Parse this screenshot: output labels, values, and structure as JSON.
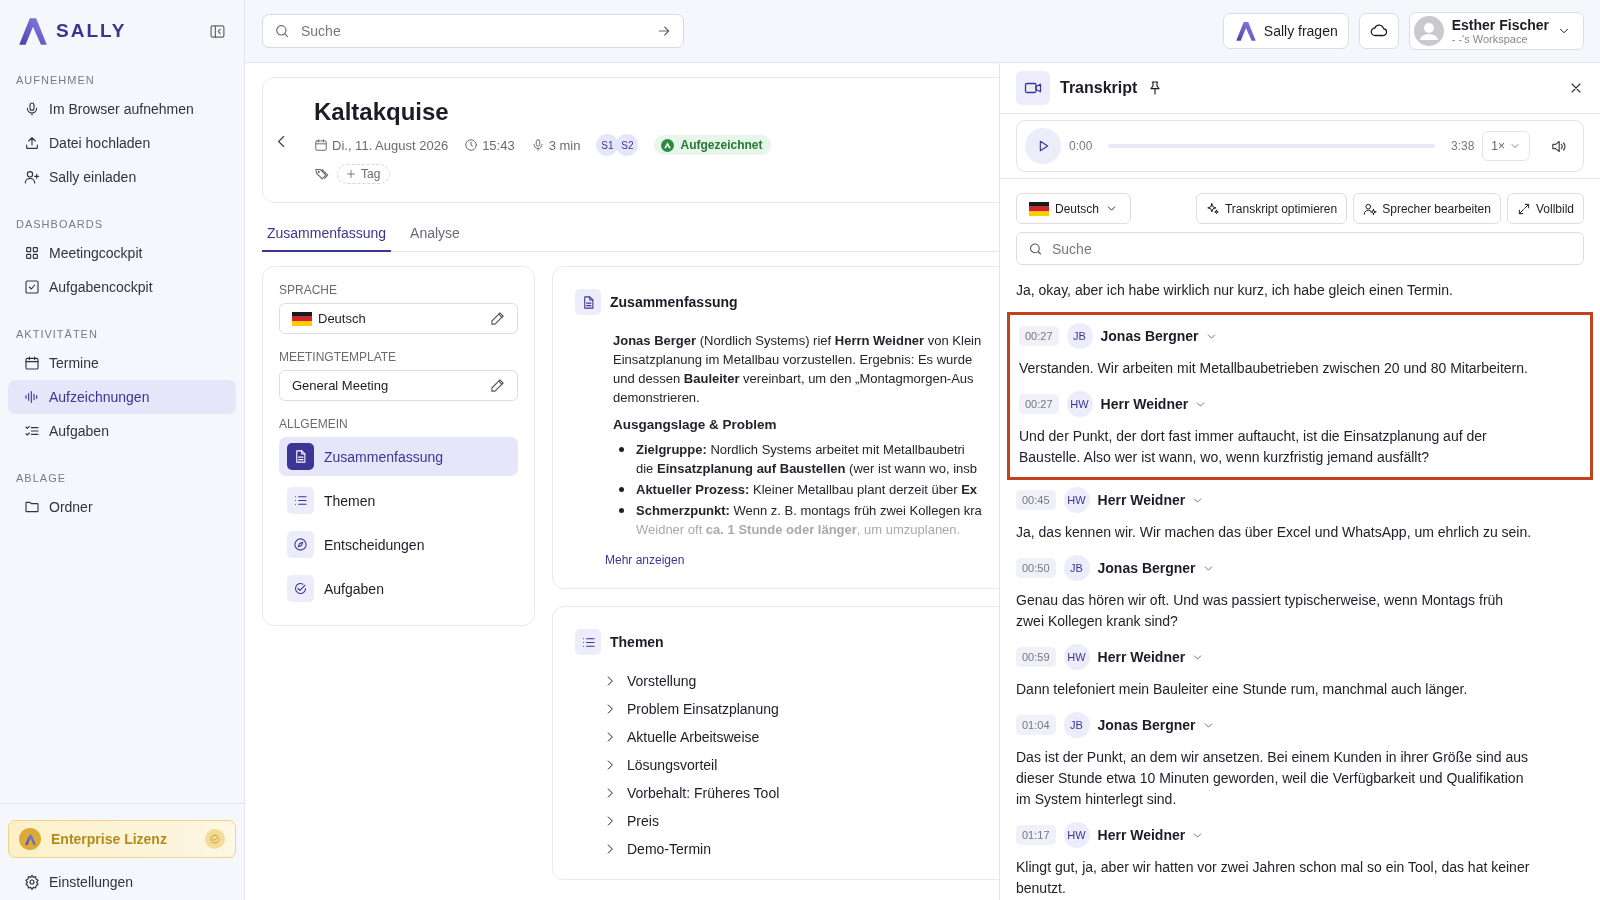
{
  "sidebar": {
    "logo": "SALLY",
    "sections": [
      {
        "title": "AUFNEHMEN",
        "items": [
          {
            "label": "Im Browser aufnehmen",
            "kind": "mic",
            "selected": false
          },
          {
            "label": "Datei hochladen",
            "kind": "upload",
            "selected": false
          },
          {
            "label": "Sally einladen",
            "kind": "invite",
            "selected": false
          }
        ]
      },
      {
        "title": "DASHBOARDS",
        "items": [
          {
            "label": "Meetingcockpit",
            "kind": "grid",
            "selected": false
          },
          {
            "label": "Aufgabencockpit",
            "kind": "checkbox",
            "selected": false
          }
        ]
      },
      {
        "title": "AKTIVITÄTEN",
        "items": [
          {
            "label": "Termine",
            "kind": "calendar",
            "selected": false
          },
          {
            "label": "Aufzeichnungen",
            "kind": "wave",
            "selected": true
          },
          {
            "label": "Aufgaben",
            "kind": "tasks",
            "selected": false
          }
        ]
      },
      {
        "title": "ABLAGE",
        "items": [
          {
            "label": "Ordner",
            "kind": "folder",
            "selected": false
          }
        ]
      }
    ],
    "license": "Enterprise Lizenz",
    "settings": "Einstellungen"
  },
  "topbar": {
    "search_placeholder": "Suche",
    "ask_button": "Sally fragen",
    "user": {
      "name": "Esther Fischer",
      "workspace": "- -'s Workspace"
    }
  },
  "meeting": {
    "title": "Kaltakquise",
    "date": "Di., 11. August 2026",
    "time": "15:43",
    "duration": "3 min",
    "speakers": [
      "S1",
      "S2"
    ],
    "status": "Aufgezeichnet",
    "tag_button": "Tag"
  },
  "tabs": [
    {
      "label": "Zusammenfassung",
      "selected": true
    },
    {
      "label": "Analyse",
      "selected": false
    }
  ],
  "settings_card": {
    "language_label": "SPRACHE",
    "language": "Deutsch",
    "template_label": "MEETINGTEMPLATE",
    "template": "General Meeting",
    "section_label": "ALLGEMEIN",
    "nav": [
      {
        "label": "Zusammenfassung",
        "kind": "document",
        "selected": true
      },
      {
        "label": "Themen",
        "kind": "list",
        "selected": false
      },
      {
        "label": "Entscheidungen",
        "kind": "compass",
        "selected": false
      },
      {
        "label": "Aufgaben",
        "kind": "check",
        "selected": false
      }
    ]
  },
  "summary_card": {
    "title": "Zusammenfassung",
    "intro_lines": [
      "**Jonas Berger** (Nordlich Systems) rief **Herrn Weidner** von Klein",
      "Einsatzplanung im Metallbau vorzustellen. Ergebnis: Es wurde",
      "und dessen **Bauleiter** vereinbart, um den „Montagmorgen-Aus",
      "demonstrieren."
    ],
    "heading": "Ausgangslage & Problem",
    "bullets": [
      {
        "lines": [
          "**Zielgruppe:** Nordlich Systems arbeitet mit Metallbaubetri",
          "die **Einsatzplanung auf Baustellen** (wer ist wann wo, insb"
        ]
      },
      {
        "lines": [
          "**Aktueller Prozess:** Kleiner Metallbau plant derzeit über **Ex**"
        ]
      },
      {
        "lines": [
          "**Schmerzpunkt:** Wenn z. B. montags früh zwei Kollegen kra",
          "Weidner oft **ca. 1 Stunde oder länger**, um umzuplanen."
        ]
      }
    ],
    "more_link": "Mehr anzeigen"
  },
  "topics_card": {
    "title": "Themen",
    "topics": [
      "Vorstellung",
      "Problem Einsatzplanung",
      "Aktuelle Arbeitsweise",
      "Lösungsvorteil",
      "Vorbehalt: Früheres Tool",
      "Preis",
      "Demo-Termin"
    ]
  },
  "transcript": {
    "title": "Transkript",
    "player": {
      "current": "0:00",
      "level": 0,
      "total": "3:38",
      "speed": "1×"
    },
    "language": "Deutsch",
    "actions": [
      {
        "label": "Transkript optimieren",
        "kind": "sparkle"
      },
      {
        "label": "Sprecher bearbeiten",
        "kind": "speaker"
      },
      {
        "label": "Vollbild",
        "kind": "expand"
      }
    ],
    "search_placeholder": "Suche",
    "entries": [
      {
        "text": "Ja, okay, aber ich habe wirklich nur kurz, ich habe gleich einen Termin.",
        "highlighted": false
      },
      {
        "time": "00:27",
        "initials": "JB",
        "speaker": "Jonas Bergner",
        "text": "Verstanden. Wir arbeiten mit Metallbaubetrieben zwischen 20 und 80 Mitarbeitern.",
        "highlighted": true
      },
      {
        "time": "00:27",
        "initials": "HW",
        "speaker": "Herr Weidner",
        "text": "Und der Punkt, der dort fast immer auftaucht, ist die Einsatzplanung auf der Baustelle. Also wer ist wann, wo, wenn kurzfristig jemand ausfällt?",
        "highlighted": true
      },
      {
        "time": "00:45",
        "initials": "HW",
        "speaker": "Herr Weidner",
        "text": "Ja, das kennen wir. Wir machen das über Excel und WhatsApp, um ehrlich zu sein.",
        "highlighted": false
      },
      {
        "time": "00:50",
        "initials": "JB",
        "speaker": "Jonas Bergner",
        "text": "Genau das hören wir oft. Und was passiert typischerweise, wenn Montags früh zwei Kollegen krank sind?",
        "highlighted": false
      },
      {
        "time": "00:59",
        "initials": "HW",
        "speaker": "Herr Weidner",
        "text": "Dann telefoniert mein Bauleiter eine Stunde rum, manchmal auch länger.",
        "highlighted": false
      },
      {
        "time": "01:04",
        "initials": "JB",
        "speaker": "Jonas Bergner",
        "text": "Das ist der Punkt, an dem wir ansetzen. Bei einem Kunden in ihrer Größe sind aus dieser Stunde etwa 10 Minuten geworden, weil die Verfügbarkeit und Qualifikation im System hinterlegt sind.",
        "highlighted": false
      },
      {
        "time": "01:17",
        "initials": "HW",
        "speaker": "Herr Weidner",
        "text": "Klingt gut, ja, aber wir hatten vor zwei Jahren schon mal so ein Tool, das hat keiner benutzt.",
        "highlighted": false
      }
    ]
  }
}
